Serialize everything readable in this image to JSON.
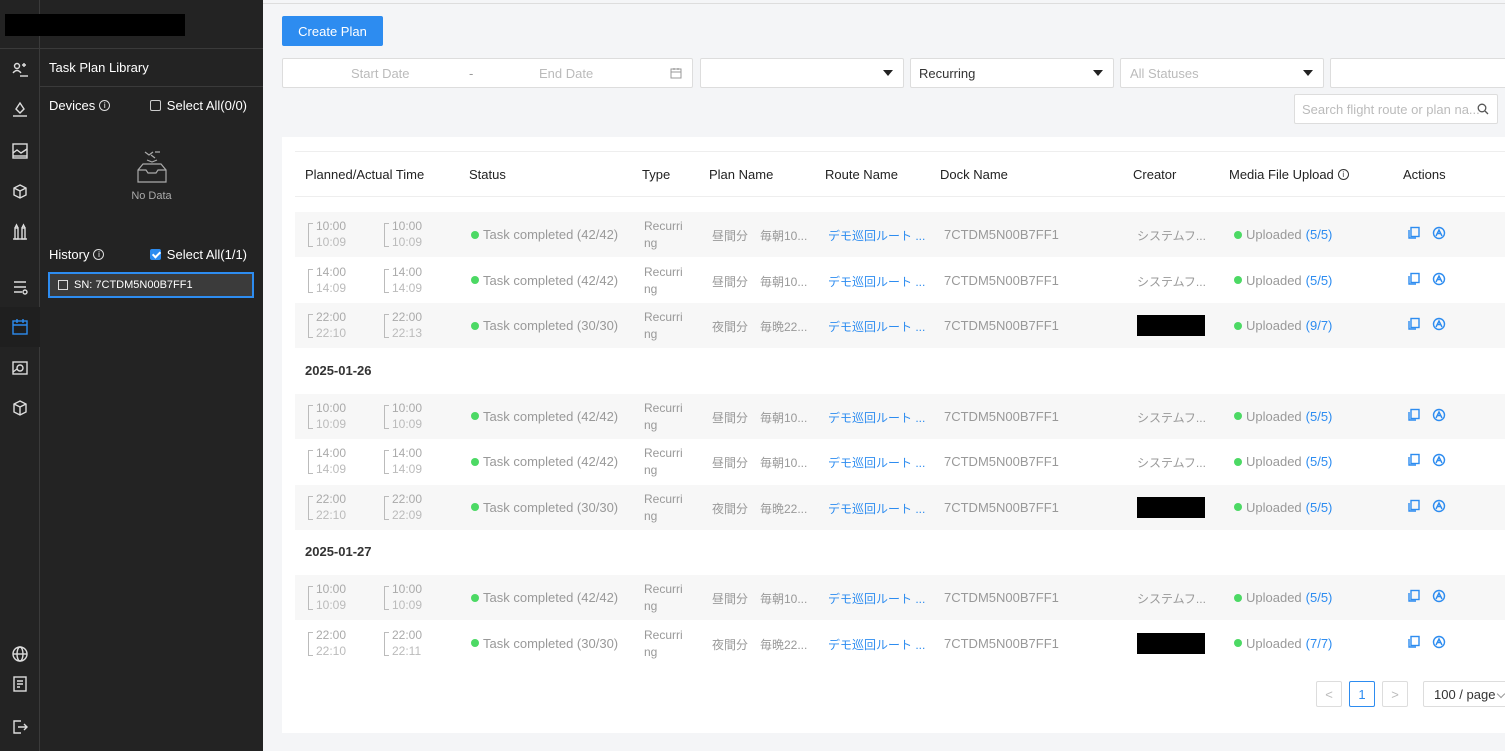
{
  "sidebar": {
    "library_title": "Task Plan Library",
    "devices_label": "Devices",
    "devices_select_all": "Select All(0/0)",
    "no_data": "No Data",
    "history_label": "History",
    "history_select_all": "Select All(1/1)",
    "history_item": "SN: 7CTDM5N00B7FF1"
  },
  "toolbar": {
    "create_label": "Create Plan",
    "start_placeholder": "Start Date",
    "date_sep": "-",
    "end_placeholder": "End Date",
    "type_value": "Recurring",
    "status_placeholder": "All Statuses",
    "search_placeholder": "Search flight route or plan na..."
  },
  "table": {
    "headers": {
      "time": "Planned/Actual Time",
      "status": "Status",
      "type": "Type",
      "plan": "Plan Name",
      "route": "Route Name",
      "dock": "Dock Name",
      "creator": "Creator",
      "media": "Media File Upload",
      "actions": "Actions"
    },
    "groups": [
      {
        "date": "",
        "rows": [
          {
            "p1": "10:00",
            "p2": "10:09",
            "a1": "10:00",
            "a2": "10:09",
            "status": "Task completed (42/42)",
            "type": "Recurring",
            "plan": "昼間分　毎朝10...",
            "route": "デモ巡回ルート ...",
            "dock": "7CTDM5N00B7FF1",
            "creator": "システムフ...",
            "upload": "Uploaded",
            "count": "(5/5)"
          },
          {
            "p1": "14:00",
            "p2": "14:09",
            "a1": "14:00",
            "a2": "14:09",
            "status": "Task completed (42/42)",
            "type": "Recurring",
            "plan": "昼間分　毎朝10...",
            "route": "デモ巡回ルート ...",
            "dock": "7CTDM5N00B7FF1",
            "creator": "システムフ...",
            "upload": "Uploaded",
            "count": "(5/5)"
          },
          {
            "p1": "22:00",
            "p2": "22:10",
            "a1": "22:00",
            "a2": "22:13",
            "status": "Task completed (30/30)",
            "type": "Recurring",
            "plan": "夜間分　毎晩22...",
            "route": "デモ巡回ルート ...",
            "dock": "7CTDM5N00B7FF1",
            "creator": "",
            "upload": "Uploaded",
            "count": "(9/7)"
          }
        ]
      },
      {
        "date": "2025-01-26",
        "rows": [
          {
            "p1": "10:00",
            "p2": "10:09",
            "a1": "10:00",
            "a2": "10:09",
            "status": "Task completed (42/42)",
            "type": "Recurring",
            "plan": "昼間分　毎朝10...",
            "route": "デモ巡回ルート ...",
            "dock": "7CTDM5N00B7FF1",
            "creator": "システムフ...",
            "upload": "Uploaded",
            "count": "(5/5)"
          },
          {
            "p1": "14:00",
            "p2": "14:09",
            "a1": "14:00",
            "a2": "14:09",
            "status": "Task completed (42/42)",
            "type": "Recurring",
            "plan": "昼間分　毎朝10...",
            "route": "デモ巡回ルート ...",
            "dock": "7CTDM5N00B7FF1",
            "creator": "システムフ...",
            "upload": "Uploaded",
            "count": "(5/5)"
          },
          {
            "p1": "22:00",
            "p2": "22:10",
            "a1": "22:00",
            "a2": "22:09",
            "status": "Task completed (30/30)",
            "type": "Recurring",
            "plan": "夜間分　毎晩22...",
            "route": "デモ巡回ルート ...",
            "dock": "7CTDM5N00B7FF1",
            "creator": "",
            "upload": "Uploaded",
            "count": "(5/5)"
          }
        ]
      },
      {
        "date": "2025-01-27",
        "rows": [
          {
            "p1": "10:00",
            "p2": "10:09",
            "a1": "10:00",
            "a2": "10:09",
            "status": "Task completed (42/42)",
            "type": "Recurring",
            "plan": "昼間分　毎朝10...",
            "route": "デモ巡回ルート ...",
            "dock": "7CTDM5N00B7FF1",
            "creator": "システムフ...",
            "upload": "Uploaded",
            "count": "(5/5)"
          },
          {
            "p1": "22:00",
            "p2": "22:10",
            "a1": "22:00",
            "a2": "22:11",
            "status": "Task completed (30/30)",
            "type": "Recurring",
            "plan": "夜間分　毎晩22...",
            "route": "デモ巡回ルート ...",
            "dock": "7CTDM5N00B7FF1",
            "creator": "",
            "upload": "Uploaded",
            "count": "(7/7)"
          }
        ]
      }
    ]
  },
  "pagination": {
    "prev": "<",
    "current": "1",
    "next": ">",
    "per_page": "100 / page"
  }
}
